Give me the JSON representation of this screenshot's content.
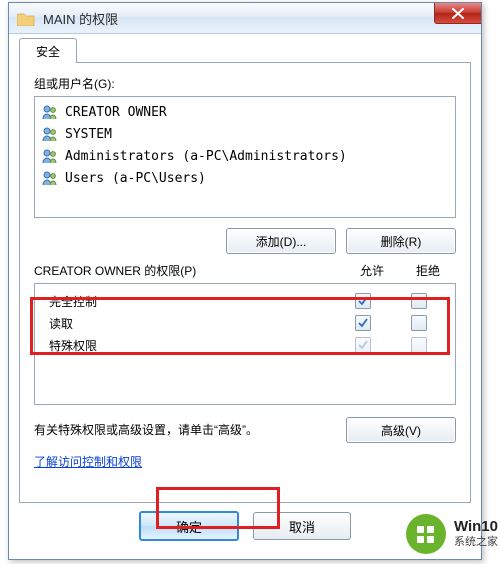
{
  "window": {
    "title": "MAIN 的权限"
  },
  "tab": {
    "security": "安全"
  },
  "groups_label": "组或用户名(G):",
  "users": [
    {
      "name": "CREATOR OWNER"
    },
    {
      "name": "SYSTEM"
    },
    {
      "name": "Administrators (a-PC\\Administrators)"
    },
    {
      "name": "Users (a-PC\\Users)"
    }
  ],
  "buttons": {
    "add": "添加(D)...",
    "remove": "删除(R)",
    "advanced": "高级(V)",
    "ok": "确定",
    "cancel": "取消"
  },
  "perm_label": "CREATOR OWNER 的权限(P)",
  "cols": {
    "allow": "允许",
    "deny": "拒绝"
  },
  "perms": [
    {
      "name": "完全控制",
      "allow": true,
      "deny": false
    },
    {
      "name": "读取",
      "allow": true,
      "deny": false
    },
    {
      "name": "特殊权限",
      "allow": true,
      "deny": false,
      "disabled": true
    }
  ],
  "specperm_text": "有关特殊权限或高级设置，请单击“高级”。",
  "link_text": "了解访问控制和权限",
  "brand": {
    "line1": "Win10",
    "line2": "系统之家"
  }
}
